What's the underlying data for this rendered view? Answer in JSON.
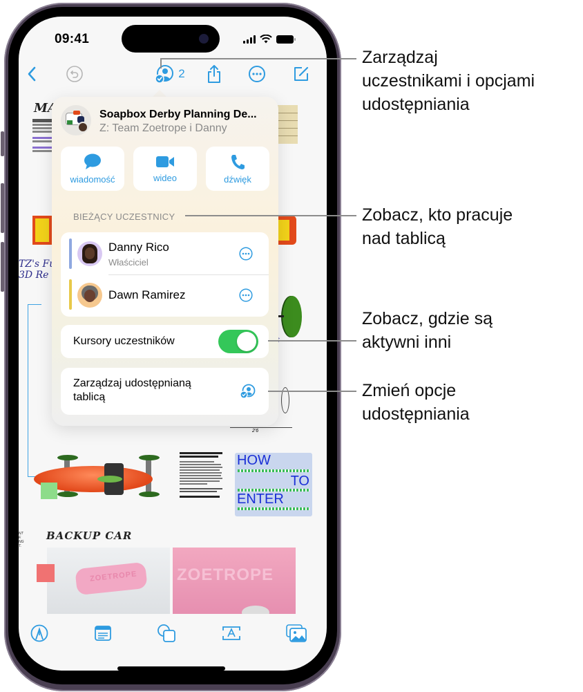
{
  "status_bar": {
    "time": "09:41"
  },
  "toolbar": {
    "back_icon": "chevron-left-icon",
    "undo_icon": "undo-icon",
    "collaborators_icon": "person-circle-checkmark-icon",
    "collaborator_count": "2",
    "share_icon": "share-icon",
    "more_icon": "ellipsis-circle-icon",
    "compose_icon": "compose-icon"
  },
  "popover": {
    "board_title": "Soapbox Derby Planning De...",
    "board_subtitle": "Z: Team Zoetrope i Danny",
    "actions": [
      {
        "label": "wiadomość",
        "icon": "message-bubble-icon"
      },
      {
        "label": "wideo",
        "icon": "video-camera-icon"
      },
      {
        "label": "dźwięk",
        "icon": "phone-icon"
      }
    ],
    "participants_header": "BIEŻĄCY UCZESTNICY",
    "participants": [
      {
        "name": "Danny Rico",
        "role": "Właściciel",
        "color": "#8fa8e0"
      },
      {
        "name": "Dawn Ramirez",
        "role": "",
        "color": "#e8c94a"
      }
    ],
    "cursor_toggle": {
      "label": "Kursory uczestników",
      "on": true
    },
    "manage_row": {
      "label_line1": "Zarządzaj udostępnianą",
      "label_line2": "tablicą"
    }
  },
  "board": {
    "backup_car_title": "BACKUP CAR",
    "standards_heading": "Here are the standards we need to meet to qualify for the race.",
    "how_to_enter": [
      "HOW",
      "TO",
      "ENTER"
    ]
  },
  "bottom_toolbar": [
    {
      "icon": "pen-tip-icon"
    },
    {
      "icon": "sticky-note-icon"
    },
    {
      "icon": "shapes-icon"
    },
    {
      "icon": "text-box-icon"
    },
    {
      "icon": "photo-icon"
    }
  ],
  "callouts": [
    {
      "lines": [
        "Zarządzaj",
        "uczestnikami i opcjami",
        "udostępniania"
      ]
    },
    {
      "lines": [
        "Zobacz, kto pracuje",
        "nad tablicą"
      ]
    },
    {
      "lines": [
        "Zobacz, gdzie są",
        "aktywni inni"
      ]
    },
    {
      "lines": [
        "Zmień opcje",
        "udostępniania"
      ]
    }
  ],
  "colors": {
    "accent": "#2e9be0",
    "toggle_on": "#34c759"
  }
}
